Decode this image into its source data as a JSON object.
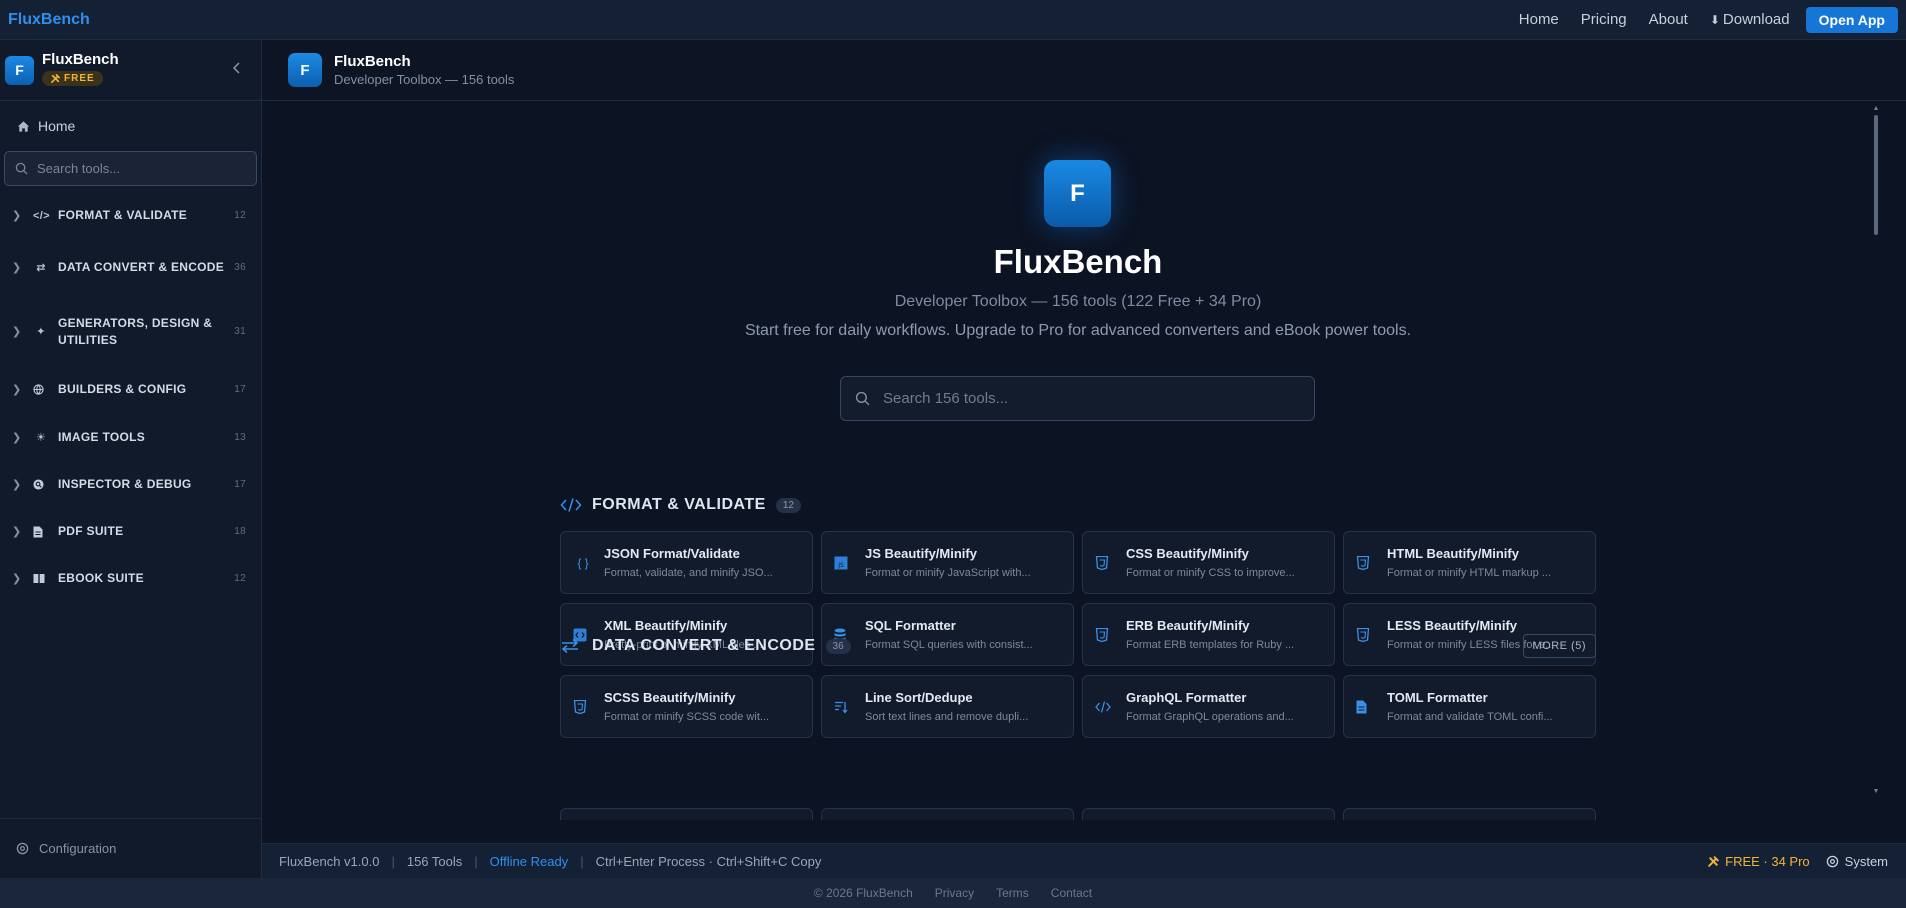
{
  "topnav": {
    "brand": "FluxBench",
    "links": [
      "Home",
      "Pricing",
      "About"
    ],
    "download": "Download",
    "open_app": "Open App"
  },
  "sidebar": {
    "brand": "FluxBench",
    "badge": "FREE",
    "home": "Home",
    "search_placeholder": "Search tools...",
    "categories": [
      {
        "label": "FORMAT & VALIDATE",
        "count": "12",
        "icon": "code-icon"
      },
      {
        "label": "DATA CONVERT & ENCODE",
        "count": "36",
        "icon": "swap-icon"
      },
      {
        "label": "GENERATORS, DESIGN & UTILITIES",
        "count": "31",
        "icon": "sparkle-icon"
      },
      {
        "label": "BUILDERS & CONFIG",
        "count": "17",
        "icon": "globe-icon"
      },
      {
        "label": "IMAGE TOOLS",
        "count": "13",
        "icon": "sun-icon"
      },
      {
        "label": "INSPECTOR & DEBUG",
        "count": "17",
        "icon": "inspect-icon"
      },
      {
        "label": "PDF SUITE",
        "count": "18",
        "icon": "file-icon"
      },
      {
        "label": "EBOOK SUITE",
        "count": "12",
        "icon": "book-icon"
      }
    ],
    "config": "Configuration"
  },
  "page_header": {
    "title": "FluxBench",
    "subtitle": "Developer Toolbox — 156 tools"
  },
  "hero": {
    "logo_letter": "F",
    "title": "FluxBench",
    "subtitle": "Developer Toolbox — 156 tools (122 Free + 34 Pro)",
    "description": "Start free for daily workflows. Upgrade to Pro for advanced converters and eBook power tools.",
    "search_placeholder": "Search 156 tools..."
  },
  "sections": [
    {
      "title": "FORMAT & VALIDATE",
      "count": "12"
    },
    {
      "title": "DATA CONVERT & ENCODE",
      "count": "36",
      "more": "MORE (5)"
    }
  ],
  "tools": [
    {
      "name": "JSON Format/Validate",
      "desc": "Format, validate, and minify JSO...",
      "icon": "braces-icon"
    },
    {
      "name": "JS Beautify/Minify",
      "desc": "Format or minify JavaScript with...",
      "icon": "js-icon"
    },
    {
      "name": "CSS Beautify/Minify",
      "desc": "Format or minify CSS to improve...",
      "icon": "css-icon"
    },
    {
      "name": "HTML Beautify/Minify",
      "desc": "Format or minify HTML markup ...",
      "icon": "html-icon"
    },
    {
      "name": "XML Beautify/Minify",
      "desc": "Pretty-print or minify XML files ...",
      "icon": "xml-icon"
    },
    {
      "name": "SQL Formatter",
      "desc": "Format SQL queries with consist...",
      "icon": "database-icon"
    },
    {
      "name": "ERB Beautify/Minify",
      "desc": "Format ERB templates for Ruby ...",
      "icon": "erb-icon"
    },
    {
      "name": "LESS Beautify/Minify",
      "desc": "Format or minify LESS files for e...",
      "icon": "less-icon"
    },
    {
      "name": "SCSS Beautify/Minify",
      "desc": "Format or minify SCSS code wit...",
      "icon": "scss-icon"
    },
    {
      "name": "Line Sort/Dedupe",
      "desc": "Sort text lines and remove dupli...",
      "icon": "sort-icon"
    },
    {
      "name": "GraphQL Formatter",
      "desc": "Format GraphQL operations and...",
      "icon": "code-icon"
    },
    {
      "name": "TOML Formatter",
      "desc": "Format and validate TOML confi...",
      "icon": "file-icon"
    }
  ],
  "status": {
    "version": "FluxBench v1.0.0",
    "tools": "156 Tools",
    "offline": "Offline Ready",
    "shortcuts": "Ctrl+Enter Process · Ctrl+Shift+C Copy",
    "plan": "FREE · 34 Pro",
    "theme": "System"
  },
  "footer": {
    "copyright": "© 2026 FluxBench",
    "links": [
      "Privacy",
      "Terms",
      "Contact"
    ]
  },
  "colors": {
    "accent": "#2f8ff0",
    "background": "#0c1322",
    "free_badge": "#f0b43a"
  }
}
